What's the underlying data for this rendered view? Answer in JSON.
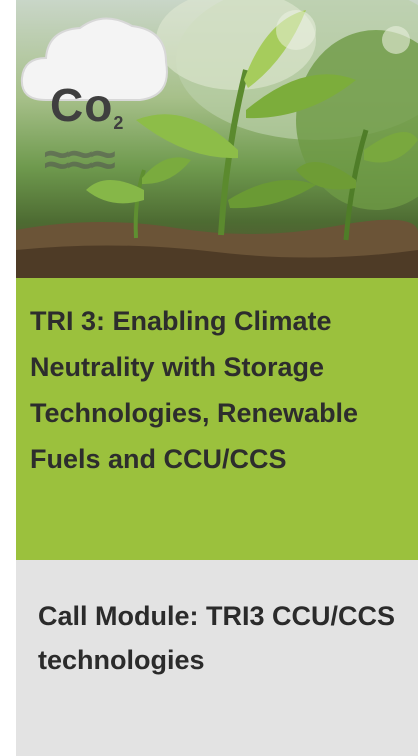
{
  "hero": {
    "icon": "co2-cloud-icon",
    "cloud_text": "Co",
    "cloud_subscript": "2"
  },
  "green_panel": {
    "title": "TRI 3: Enabling Climate Neutrality with Storage Technologies, Renewable Fuels and CCU/CCS",
    "color": "#9bc13d"
  },
  "grey_panel": {
    "module_title": "Call Module: TRI3 CCU/CCS technologies",
    "color": "#e3e3e3"
  }
}
